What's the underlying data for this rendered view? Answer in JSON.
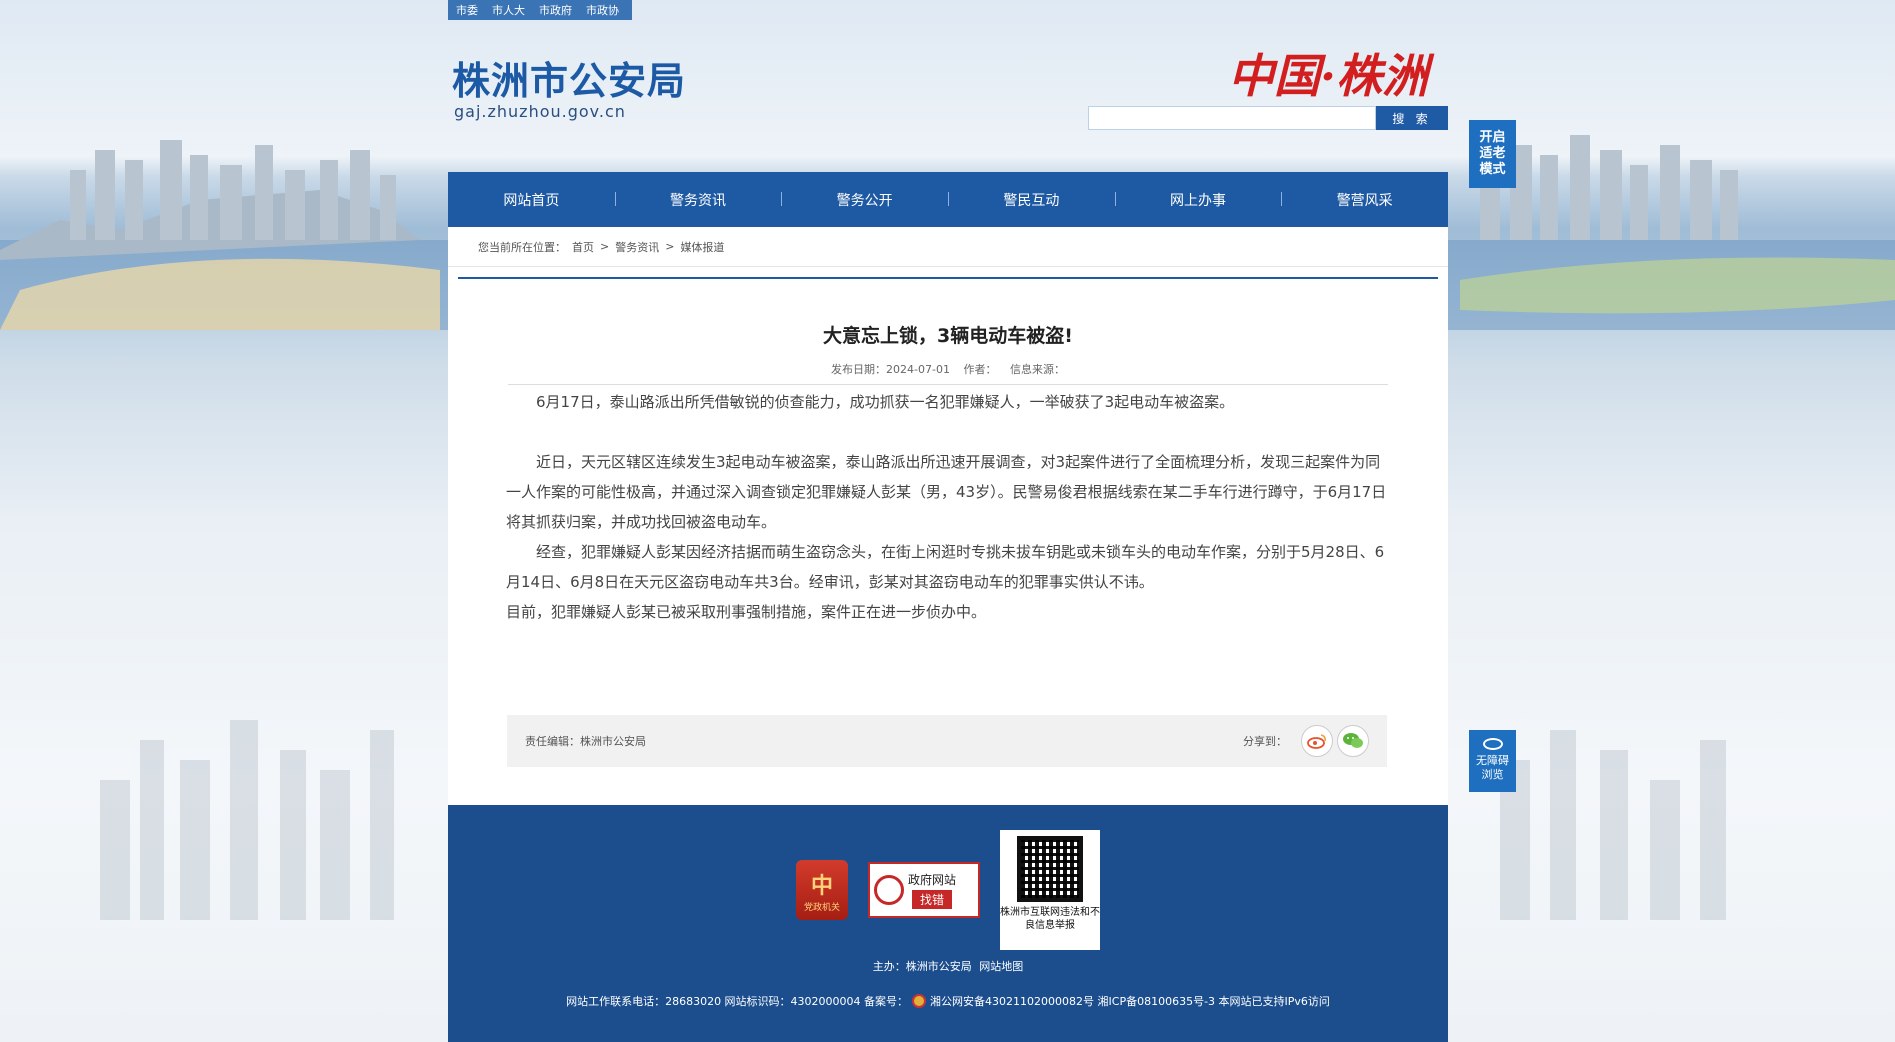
{
  "topbar": {
    "links": [
      "市委",
      "市人大",
      "市政府",
      "市政协"
    ]
  },
  "header": {
    "site_title": "株洲市公安局",
    "site_url": "gaj.zhuzhou.gov.cn",
    "calligraphy": "中国·株洲",
    "search_placeholder": "",
    "search_button": "搜 索"
  },
  "nav": {
    "items": [
      "网站首页",
      "警务资讯",
      "警务公开",
      "警民互动",
      "网上办事",
      "警营风采"
    ]
  },
  "breadcrumb": {
    "label": "您当前所在位置：",
    "path": [
      "首页",
      "警务资讯",
      "媒体报道"
    ]
  },
  "article": {
    "title": "大意忘上锁，3辆电动车被盗!",
    "date_label": "发布日期：2024-07-01",
    "author_label": "作者：",
    "source_label": "信息来源：",
    "p1": "6月17日，泰山路派出所凭借敏锐的侦查能力，成功抓获一名犯罪嫌疑人，一举破获了3起电动车被盗案。",
    "p2": "近日，天元区辖区连续发生3起电动车被盗案，泰山路派出所迅速开展调查，对3起案件进行了全面梳理分析，发现三起案件为同一人作案的可能性极高，并通过深入调查锁定犯罪嫌疑人彭某（男，43岁）。民警易俊君根据线索在某二手车行进行蹲守，于6月17日将其抓获归案，并成功找回被盗电动车。",
    "p3": "经查，犯罪嫌疑人彭某因经济拮据而萌生盗窃念头，在街上闲逛时专挑未拔车钥匙或未锁车头的电动车作案，分别于5月28日、6月14日、6月8日在天元区盗窃电动车共3台。经审讯，彭某对其盗窃电动车的犯罪事实供认不讳。",
    "p4": "目前，犯罪嫌疑人彭某已被采取刑事强制措施，案件正在进一步侦办中。",
    "editor": "责任编辑：株洲市公安局",
    "share_label": "分享到："
  },
  "footer": {
    "party_badge": "党政机关",
    "zc_badge_top": "政府网站",
    "zc_badge_bottom": "找错",
    "qr_caption": "株洲市互联网违法和不良信息举报",
    "host_label": "主办：株洲市公安局",
    "sitemap": "网站地图",
    "info_line_a": "网站工作联系电话：28683020 网站标识码：4302000004 备案号：",
    "info_line_b": "湘公网安备43021102000082号 湘ICP备08100635号-3 本网站已支持IPv6访问"
  },
  "side": {
    "elder_mode": [
      "开启",
      "适老",
      "模式"
    ],
    "accessible": [
      "无障碍",
      "浏览"
    ]
  }
}
